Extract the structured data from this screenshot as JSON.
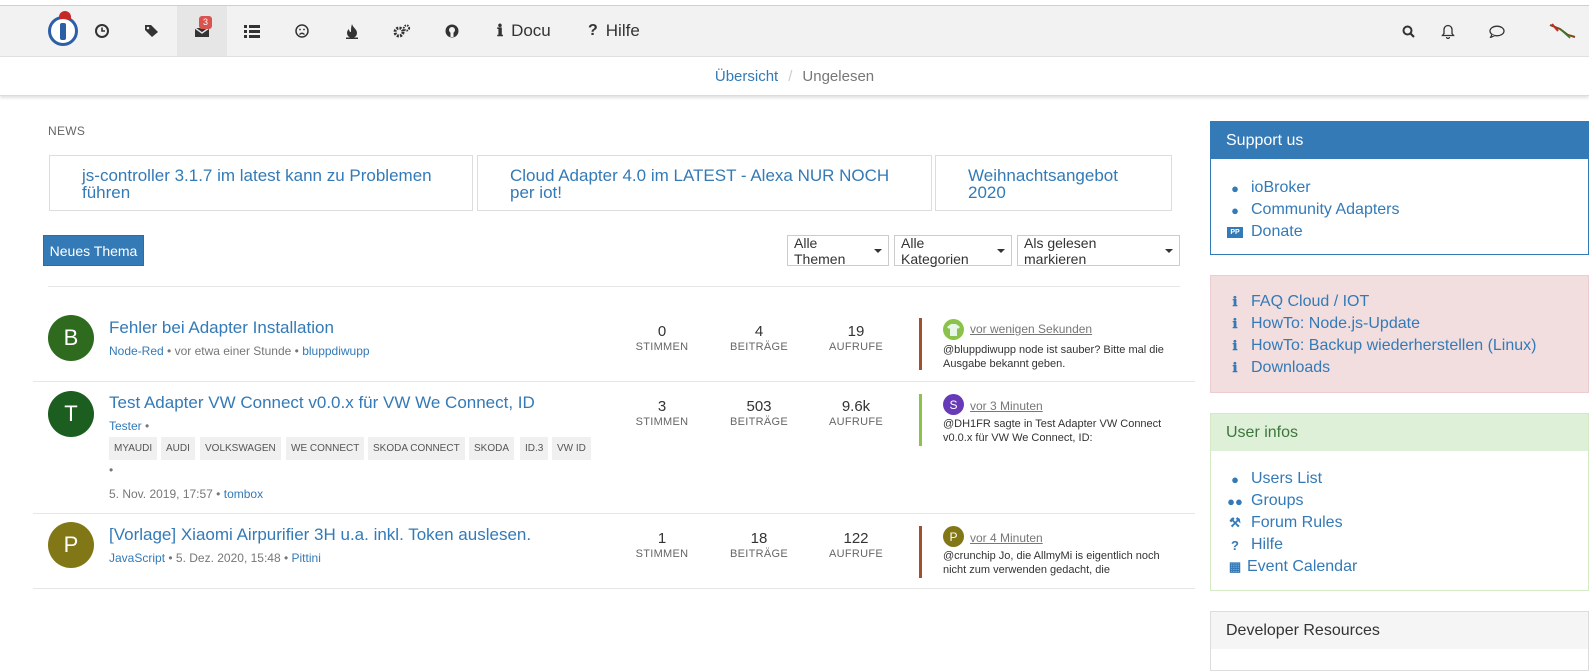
{
  "header": {
    "badge_count": "3",
    "docu_label": "Docu",
    "hilfe_label": "Hilfe"
  },
  "breadcrumb": {
    "home": "Übersicht",
    "current": "Ungelesen"
  },
  "news": {
    "label": "NEWS",
    "items": [
      "js-controller 3.1.7 im latest kann zu Problemen führen",
      "Cloud Adapter 4.0 im LATEST - Alexa NUR NOCH per iot!",
      "Weihnachtsangebot 2020"
    ]
  },
  "toolbar": {
    "new_topic": "Neues Thema",
    "filter_all": "Alle Themen",
    "filter_categories": "Alle Kategorien",
    "mark_read": "Als gelesen markieren"
  },
  "topics": [
    {
      "avatar": "B",
      "avatar_color": "#2e6b1e",
      "title": "Fehler bei Adapter Installation",
      "category": "Node-Red",
      "meta_mid": " • vor etwa einer Stunde • ",
      "author": "bluppdiwupp",
      "votes": "0",
      "votes_label": "STIMMEN",
      "posts": "4",
      "posts_label": "BEITRÄGE",
      "views": "19",
      "views_label": "AUFRUFE",
      "bar_color": "#a0522d",
      "teaser_avatar": "",
      "teaser_avatar_color": "#8bc34a",
      "teaser_time": "vor wenigen Sekunden",
      "teaser_text": "@bluppdiwupp node ist sauber? Bitte mal die Ausgabe bekannt geben."
    },
    {
      "avatar": "T",
      "avatar_color": "#1b5e20",
      "title": "Test Adapter VW Connect v0.0.x für VW We Connect, ID",
      "category": "Tester",
      "meta_mid": " •",
      "tags": [
        "MYAUDI",
        "AUDI",
        "VOLKSWAGEN",
        "WE CONNECT",
        "SKODA CONNECT",
        "SKODA",
        "ID.3",
        "VW ID"
      ],
      "date_line": "5. Nov. 2019, 17:57 • ",
      "author": "tombox",
      "votes": "3",
      "votes_label": "STIMMEN",
      "posts": "503",
      "posts_label": "BEITRÄGE",
      "views": "9.6k",
      "views_label": "AUFRUFE",
      "bar_color": "#8bc34a",
      "teaser_avatar": "S",
      "teaser_avatar_color": "#673ab7",
      "teaser_time": "vor 3 Minuten",
      "teaser_text": "@DH1FR sagte in Test Adapter VW Connect v0.0.x für VW We Connect, ID:"
    },
    {
      "avatar": "P",
      "avatar_color": "#827717",
      "title": "[Vorlage] Xiaomi Airpurifier 3H u.a. inkl. Token auslesen.",
      "category": "JavaScript",
      "meta_mid": " • 5. Dez. 2020, 15:48 • ",
      "author": "Pittini",
      "votes": "1",
      "votes_label": "STIMMEN",
      "posts": "18",
      "posts_label": "BEITRÄGE",
      "views": "122",
      "views_label": "AUFRUFE",
      "bar_color": "#a0522d",
      "teaser_avatar": "P",
      "teaser_avatar_color": "#827717",
      "teaser_time": "vor 4 Minuten",
      "teaser_text": "@crunchip Jo, die AllmyMi is eigentlich noch nicht zum verwenden gedacht, die"
    }
  ],
  "sidebar": {
    "support": {
      "title": "Support us",
      "links": [
        "ioBroker",
        "Community Adapters",
        "Donate"
      ]
    },
    "faq": {
      "links": [
        "FAQ Cloud / IOT",
        "HowTo: Node.js-Update",
        "HowTo: Backup wiederherstellen (Linux)",
        "Downloads"
      ]
    },
    "userinfo": {
      "title": "User infos",
      "links": [
        "Users List",
        "Groups",
        "Forum Rules",
        "Hilfe",
        "Event Calendar"
      ]
    },
    "dev": {
      "title": "Developer Resources"
    }
  }
}
